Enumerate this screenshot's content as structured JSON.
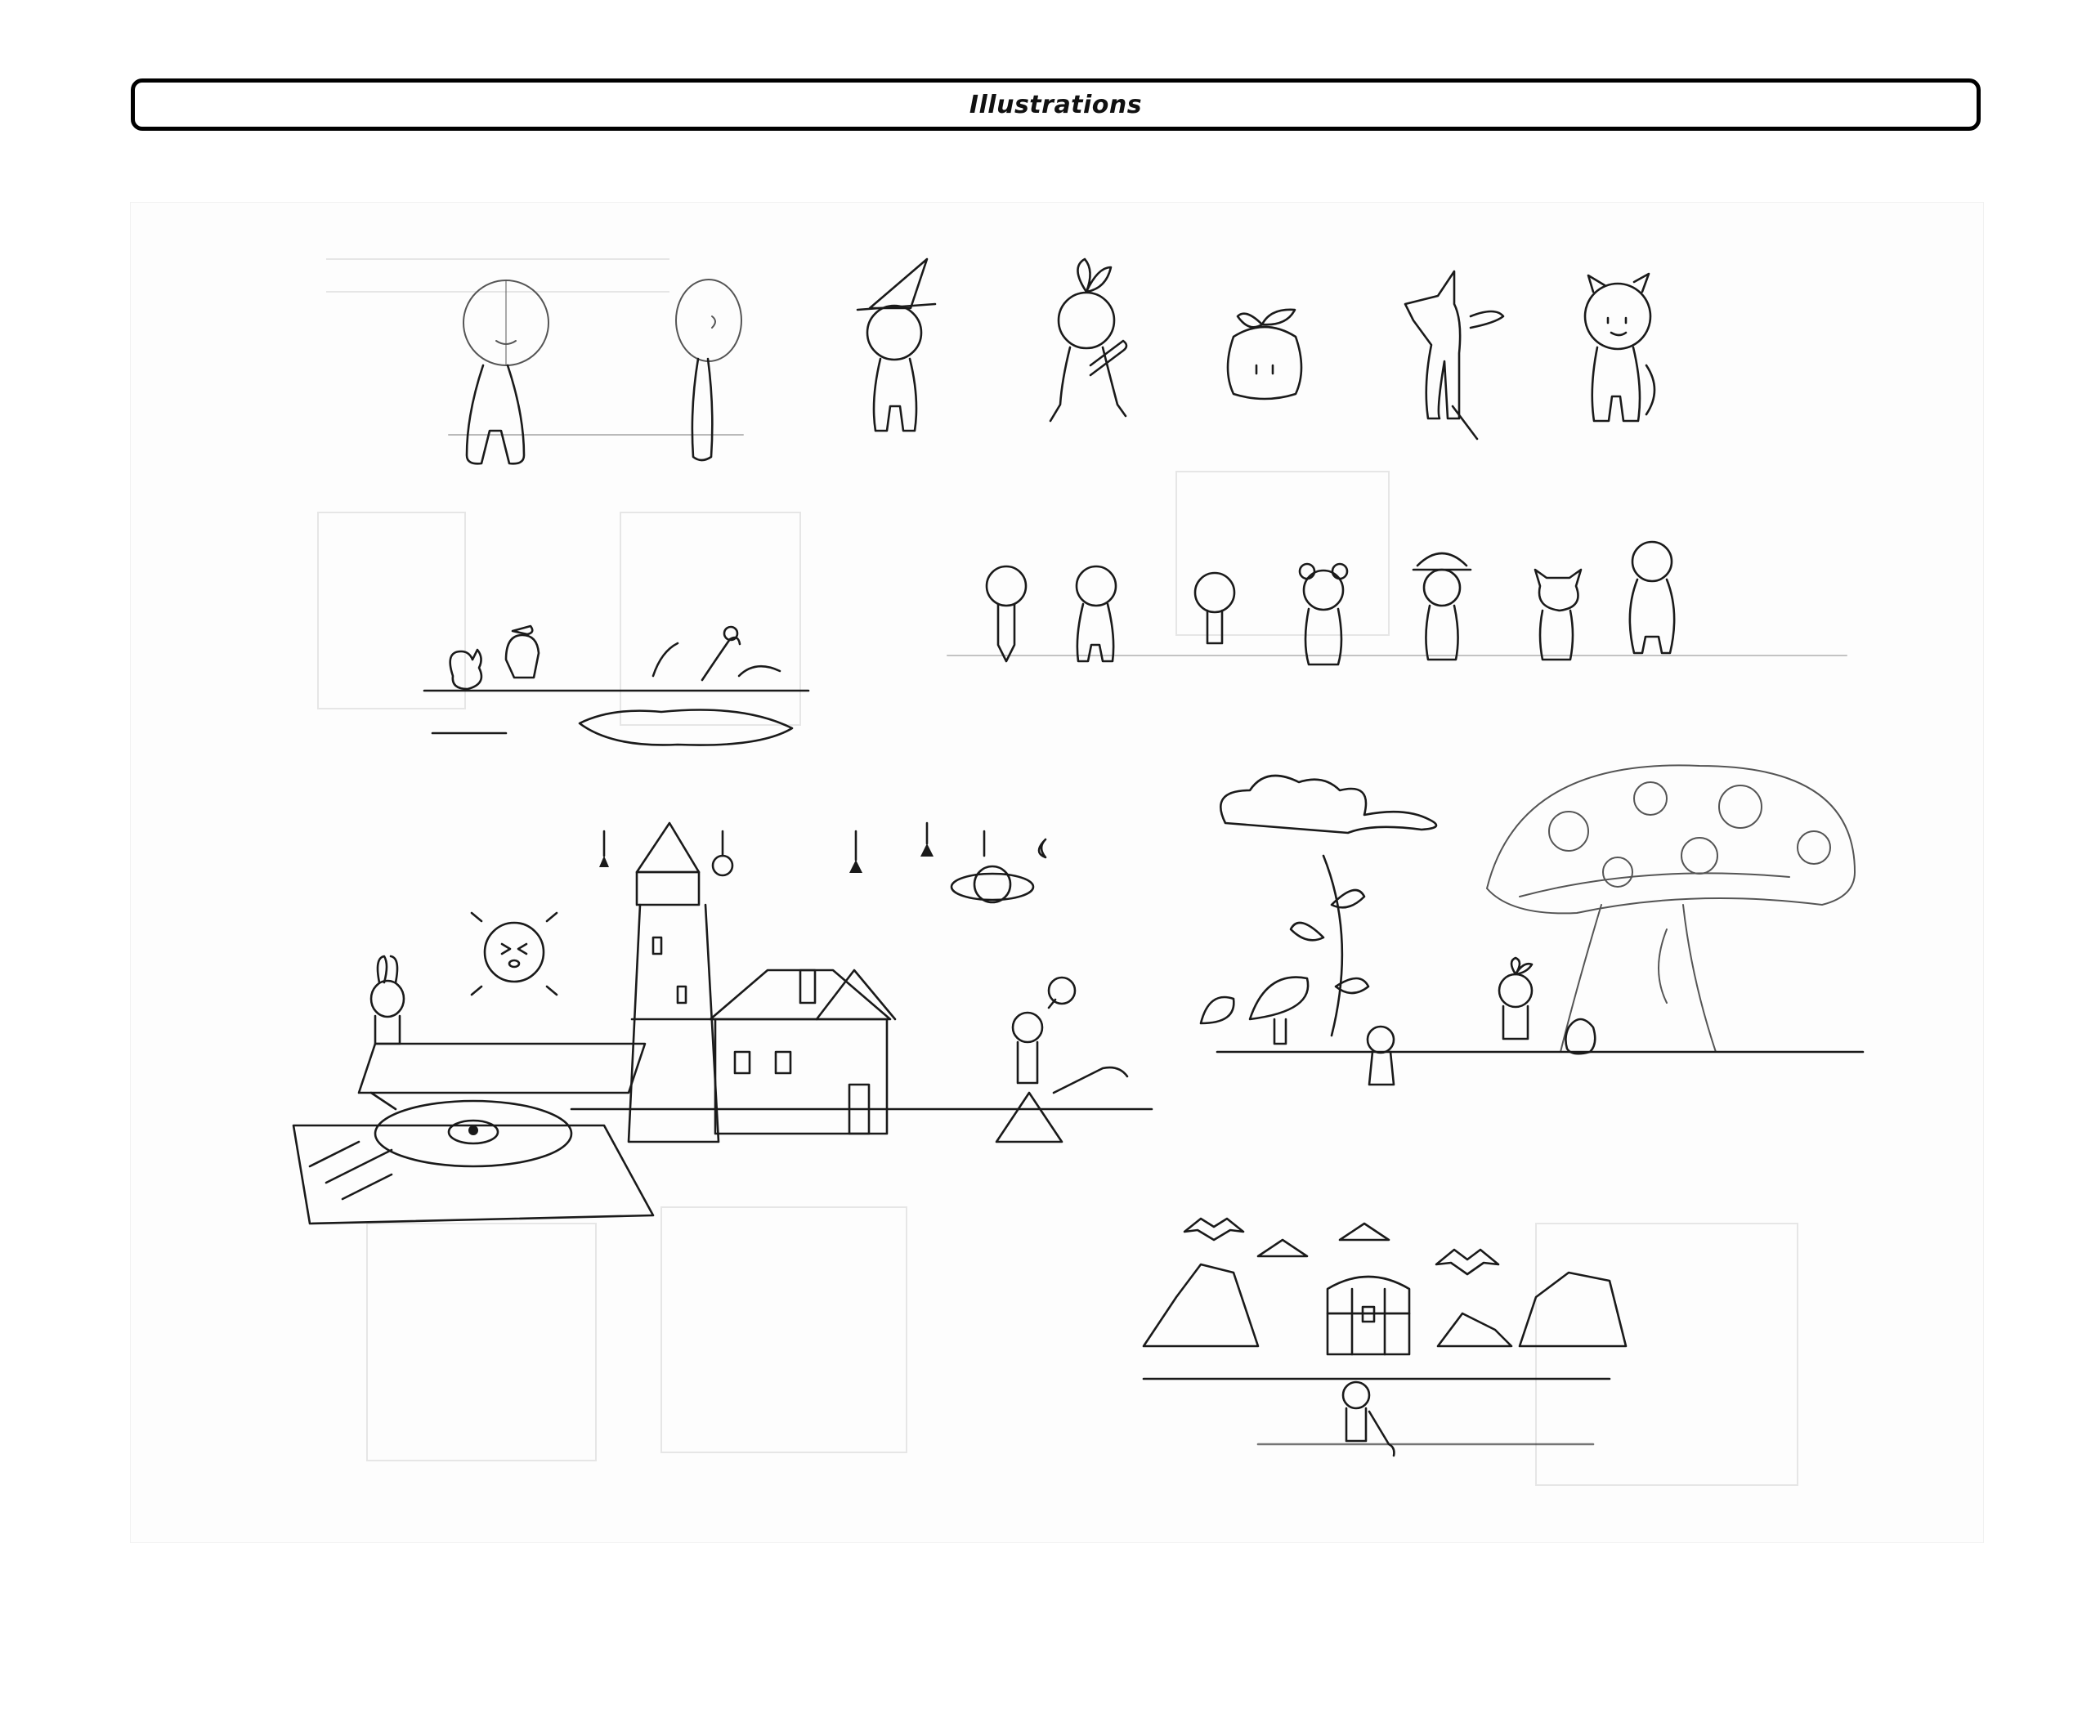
{
  "header": {
    "title": "Illustrations"
  },
  "sketchbook": {
    "groups": [
      {
        "name": "character-turnarounds"
      },
      {
        "name": "character-lineup"
      },
      {
        "name": "meadow-scene"
      },
      {
        "name": "lighthouse-village-scene"
      },
      {
        "name": "mushroom-forest-scene"
      },
      {
        "name": "treasure-cave-scene"
      }
    ]
  }
}
